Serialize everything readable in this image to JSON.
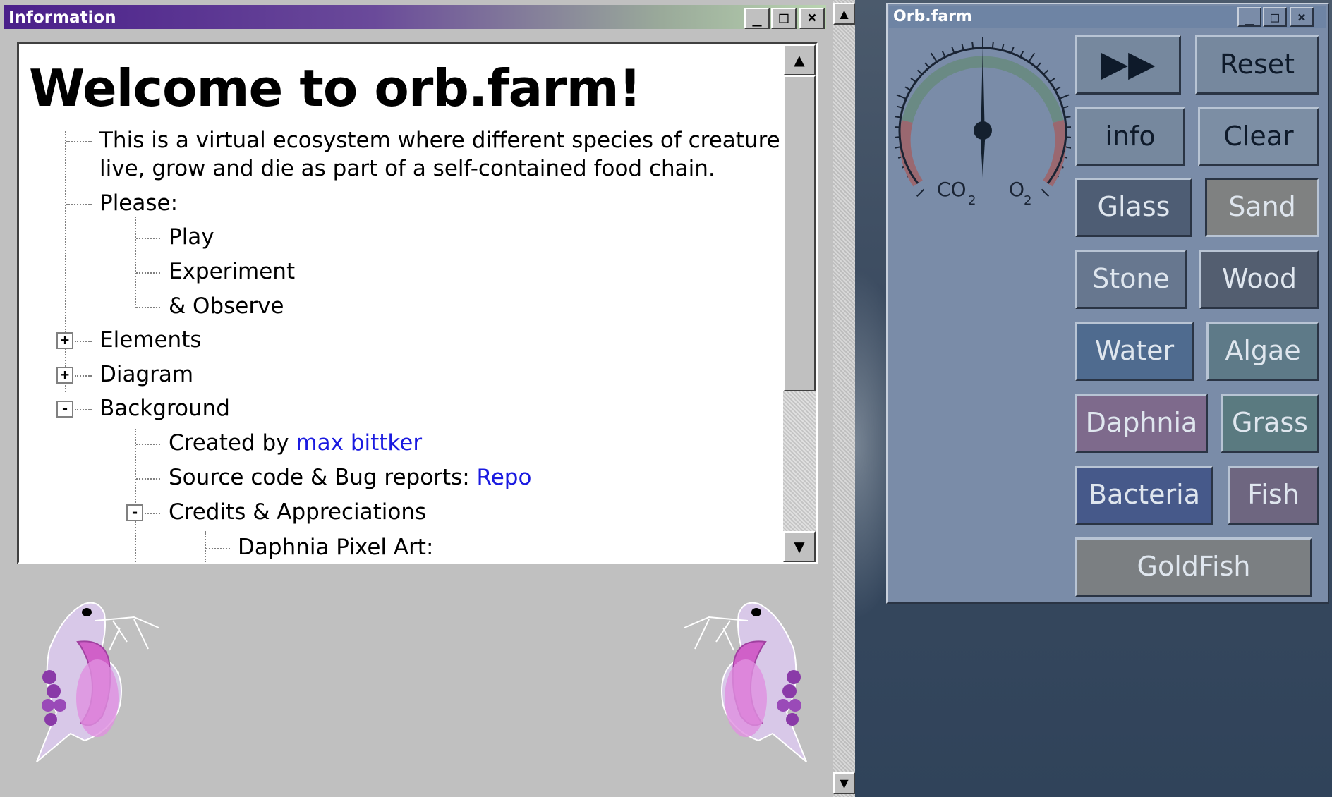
{
  "info_window": {
    "title": "Information",
    "controls": {
      "minimize": "_",
      "maximize": "□",
      "close": "×"
    },
    "heading": "Welcome to orb.farm!",
    "intro_line1": "This is a virtual ecosystem where different species of creature can",
    "intro_line2": "live, grow and die as part of a self-contained food chain.",
    "please": "Please:",
    "please_items": [
      "Play",
      "Experiment",
      "& Observe"
    ],
    "sections": {
      "elements": "Elements",
      "diagram": "Diagram",
      "background": "Background"
    },
    "expand_plus": "+",
    "expand_minus": "-",
    "created_by_prefix": "Created by ",
    "created_by_link": "max bittker",
    "source_prefix": "Source code & Bug reports: ",
    "source_link": "Repo",
    "credits": "Credits & Appreciations",
    "daphnia_art": "Daphnia Pixel Art:"
  },
  "orb_window": {
    "title": "Orb.farm",
    "gauge": {
      "left_label": "CO",
      "left_sub": "2",
      "right_label": "O",
      "right_sub": "2",
      "needle_value": 0.5
    },
    "buttons": {
      "fast_forward": "▶▶",
      "reset": "Reset",
      "info": "info",
      "clear": "Clear",
      "glass": "Glass",
      "sand": "Sand",
      "stone": "Stone",
      "wood": "Wood",
      "water": "Water",
      "algae": "Algae",
      "daphnia": "Daphnia",
      "grass": "Grass",
      "bacteria": "Bacteria",
      "fish": "Fish",
      "goldfish": "GoldFish"
    },
    "colors": {
      "glass": "#4e5d74",
      "sand": "#7f8181",
      "stone": "#67778f",
      "wood": "#535e70",
      "water": "#4f6b8f",
      "algae": "#5e7a88",
      "daphnia": "#7e6a8c",
      "grass": "#5a7a80",
      "bacteria": "#46598a",
      "fish": "#6e6680",
      "goldfish": "#7b7f82"
    }
  }
}
